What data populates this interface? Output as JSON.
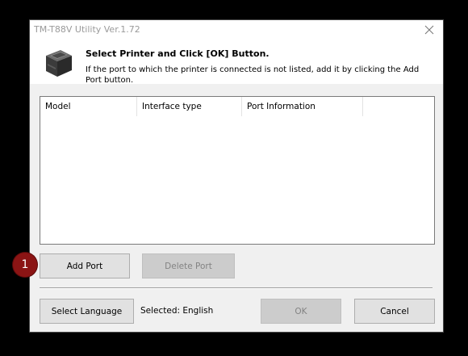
{
  "window": {
    "title": "TM-T88V Utility Ver.1.72",
    "close_icon": "close-icon"
  },
  "header": {
    "icon": "printer-icon",
    "title": "Select Printer and Click [OK] Button.",
    "description": "If the port to which the printer is connected is not listed, add it by clicking the Add Port button."
  },
  "port_list": {
    "columns": [
      "Model",
      "Interface type",
      "Port Information",
      ""
    ],
    "rows": []
  },
  "buttons": {
    "add_port": "Add Port",
    "delete_port": "Delete Port",
    "select_language": "Select Language",
    "ok": "OK",
    "cancel": "Cancel"
  },
  "language": {
    "selected_text": "Selected: English"
  },
  "annotation": {
    "step_number": "1"
  },
  "colors": {
    "badge": "#8b1414",
    "button_face": "#e1e1e1",
    "disabled_text": "#838383"
  }
}
